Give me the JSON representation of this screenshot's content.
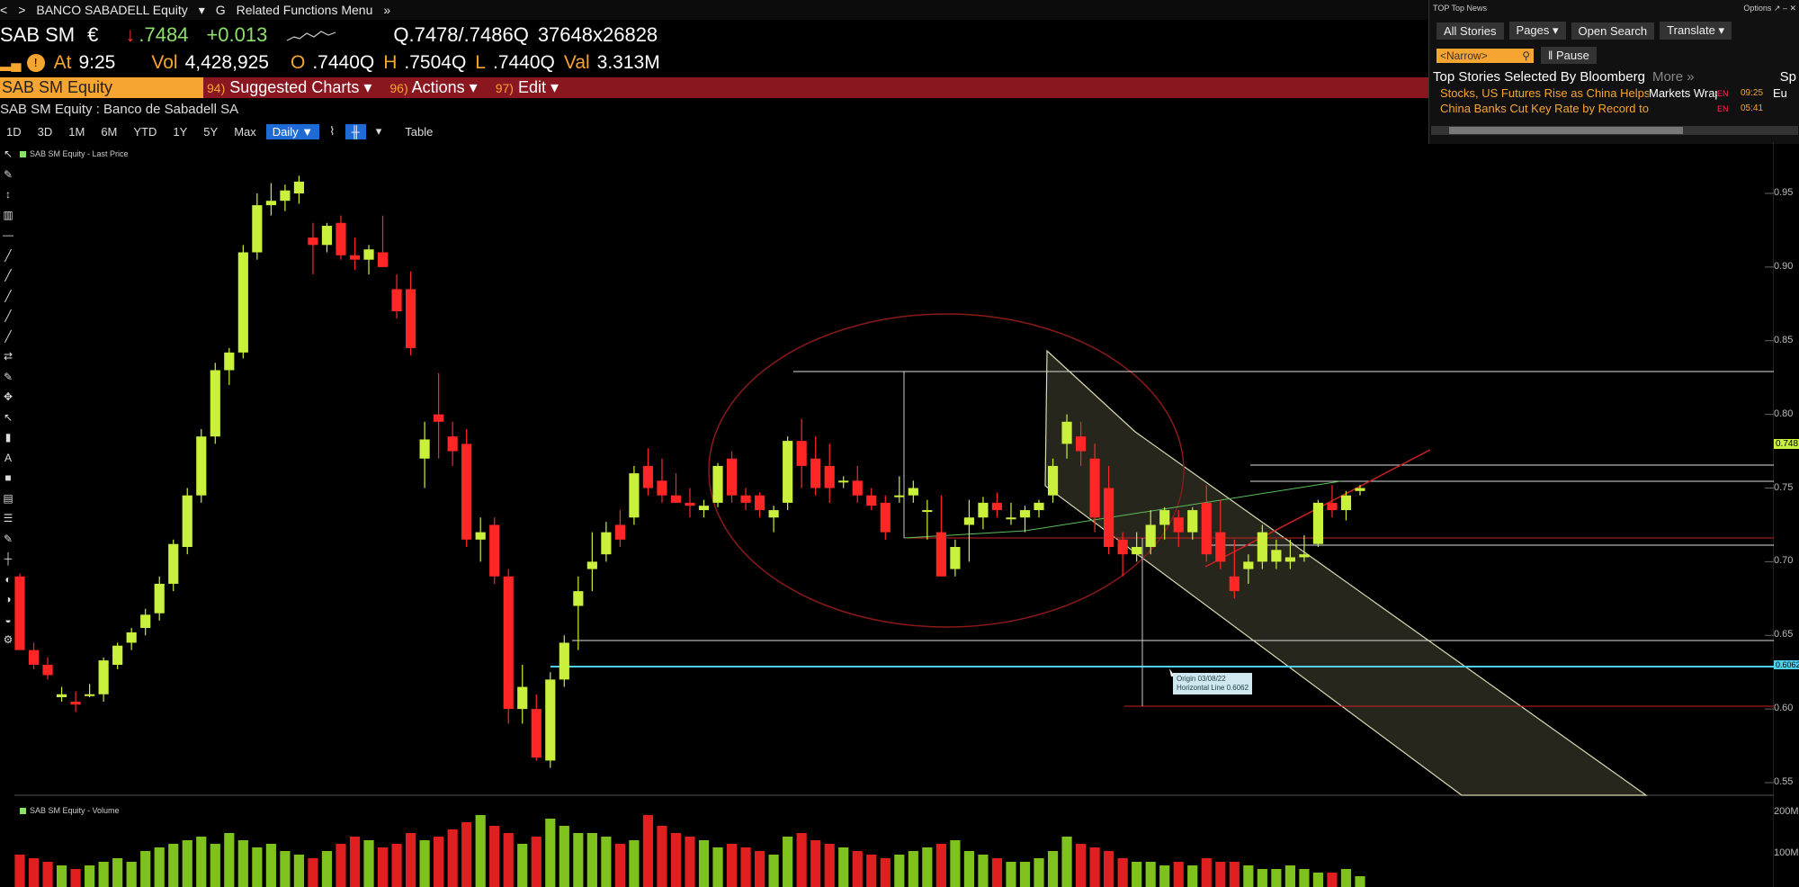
{
  "titlebar": {
    "nav_back": "<",
    "nav_fwd": ">",
    "security": "BANCO SABADELL Equity",
    "menu_g": "G",
    "related": "Related Functions Menu"
  },
  "quote": {
    "ticker": "SAB SM",
    "currency": "€",
    "arrow": "↓",
    "last": ".7484",
    "change": "+0.013",
    "bid_ask": "Q.7478/.7486Q",
    "sizes": "37648x26828",
    "at_label": "At",
    "time": "9:25",
    "vol_label": "Vol",
    "volume": "4,428,925",
    "open_label": "O",
    "open": ".7440Q",
    "high_label": "H",
    "high": ".7504Q",
    "low_label": "L",
    "low": ".7440Q",
    "val_label": "Val",
    "value": "3.313M"
  },
  "menubar": {
    "tab": "SAB SM Equity",
    "suggested_num": "94)",
    "suggested": "Suggested Charts",
    "actions_num": "96)",
    "actions": "Actions",
    "edit_num": "97)",
    "edit": "Edit"
  },
  "security_name": "SAB SM Equity : Banco de Sabadell SA",
  "toolbar": {
    "ranges": [
      "1D",
      "3D",
      "1M",
      "6M",
      "YTD",
      "1Y",
      "5Y",
      "Max"
    ],
    "period": "Daily",
    "table": "Table"
  },
  "chart_legend_price": "SAB SM Equity - Last Price",
  "chart_legend_volume": "SAB SM Equity - Volume",
  "annotation": {
    "line1": "Origin 03/08/22",
    "line2": "Horizontal Line 0.6062"
  },
  "price_tag": "0.748",
  "line_tag": "0.6062",
  "news": {
    "header": "TOP Top News",
    "options": "Options",
    "buttons": [
      "All Stories",
      "Pages",
      "Open Search",
      "Translate"
    ],
    "narrow": "<Narrow>",
    "pause": "Pause",
    "title": "Top Stories Selected By Bloomberg",
    "more": "More »",
    "side_top": "Sp",
    "side_mid": "Eu",
    "stories": [
      {
        "headline": "Stocks, US Futures Rise as China Helps…",
        "source": "Markets Wrap",
        "lang": "EN",
        "time": "09:25"
      },
      {
        "headline": "China Banks Cut Key Rate by Record to Boost Ailing…",
        "source": "",
        "lang": "EN",
        "time": "05:41"
      }
    ]
  },
  "colors": {
    "up": "#c8f03c",
    "down": "#ff2626",
    "accent": "#f7a531",
    "menubar": "#8a1620"
  },
  "chart_data": {
    "type": "candlestick",
    "yaxis_ticks": [
      0.95,
      0.9,
      0.85,
      0.8,
      0.75,
      0.7,
      0.65,
      0.6,
      0.55
    ],
    "ylim": [
      0.535,
      0.985
    ],
    "volume_ticks": [
      "200M",
      "100M"
    ],
    "candles": [
      [
        0.69,
        0.692,
        0.64,
        0.64
      ],
      [
        0.64,
        0.645,
        0.627,
        0.63
      ],
      [
        0.63,
        0.635,
        0.62,
        0.623
      ],
      [
        0.608,
        0.615,
        0.605,
        0.61
      ],
      [
        0.605,
        0.612,
        0.598,
        0.603
      ],
      [
        0.61,
        0.617,
        0.608,
        0.61
      ],
      [
        0.61,
        0.635,
        0.605,
        0.633
      ],
      [
        0.63,
        0.645,
        0.627,
        0.643
      ],
      [
        0.645,
        0.655,
        0.64,
        0.652
      ],
      [
        0.655,
        0.668,
        0.65,
        0.664
      ],
      [
        0.665,
        0.69,
        0.66,
        0.685
      ],
      [
        0.685,
        0.715,
        0.68,
        0.712
      ],
      [
        0.71,
        0.75,
        0.705,
        0.745
      ],
      [
        0.745,
        0.79,
        0.74,
        0.785
      ],
      [
        0.785,
        0.835,
        0.78,
        0.83
      ],
      [
        0.83,
        0.845,
        0.82,
        0.842
      ],
      [
        0.842,
        0.915,
        0.838,
        0.91
      ],
      [
        0.91,
        0.95,
        0.905,
        0.942
      ],
      [
        0.942,
        0.957,
        0.935,
        0.945
      ],
      [
        0.945,
        0.956,
        0.938,
        0.952
      ],
      [
        0.95,
        0.962,
        0.943,
        0.958
      ],
      [
        0.92,
        0.93,
        0.895,
        0.915
      ],
      [
        0.915,
        0.93,
        0.91,
        0.928
      ],
      [
        0.93,
        0.935,
        0.905,
        0.908
      ],
      [
        0.908,
        0.92,
        0.898,
        0.905
      ],
      [
        0.905,
        0.915,
        0.895,
        0.912
      ],
      [
        0.91,
        0.935,
        0.9,
        0.9
      ],
      [
        0.885,
        0.895,
        0.865,
        0.87
      ],
      [
        0.885,
        0.897,
        0.84,
        0.845
      ],
      [
        0.77,
        0.795,
        0.75,
        0.783
      ],
      [
        0.8,
        0.828,
        0.77,
        0.795
      ],
      [
        0.785,
        0.795,
        0.765,
        0.775
      ],
      [
        0.78,
        0.79,
        0.71,
        0.715
      ],
      [
        0.715,
        0.73,
        0.7,
        0.72
      ],
      [
        0.725,
        0.73,
        0.685,
        0.69
      ],
      [
        0.69,
        0.695,
        0.59,
        0.6
      ],
      [
        0.6,
        0.63,
        0.59,
        0.615
      ],
      [
        0.6,
        0.61,
        0.565,
        0.567
      ],
      [
        0.565,
        0.625,
        0.56,
        0.62
      ],
      [
        0.62,
        0.65,
        0.615,
        0.645
      ],
      [
        0.67,
        0.69,
        0.64,
        0.68
      ],
      [
        0.695,
        0.72,
        0.68,
        0.7
      ],
      [
        0.705,
        0.727,
        0.7,
        0.72
      ],
      [
        0.725,
        0.735,
        0.71,
        0.715
      ],
      [
        0.73,
        0.765,
        0.725,
        0.76
      ],
      [
        0.765,
        0.777,
        0.745,
        0.75
      ],
      [
        0.755,
        0.77,
        0.74,
        0.745
      ],
      [
        0.745,
        0.76,
        0.74,
        0.74
      ],
      [
        0.74,
        0.75,
        0.73,
        0.738
      ],
      [
        0.735,
        0.742,
        0.73,
        0.738
      ],
      [
        0.74,
        0.767,
        0.737,
        0.765
      ],
      [
        0.77,
        0.775,
        0.74,
        0.745
      ],
      [
        0.745,
        0.75,
        0.735,
        0.74
      ],
      [
        0.745,
        0.747,
        0.73,
        0.735
      ],
      [
        0.73,
        0.738,
        0.72,
        0.735
      ],
      [
        0.74,
        0.785,
        0.735,
        0.782
      ],
      [
        0.782,
        0.797,
        0.75,
        0.765
      ],
      [
        0.77,
        0.785,
        0.745,
        0.75
      ],
      [
        0.765,
        0.78,
        0.74,
        0.75
      ],
      [
        0.755,
        0.758,
        0.75,
        0.755
      ],
      [
        0.755,
        0.765,
        0.74,
        0.745
      ],
      [
        0.745,
        0.75,
        0.735,
        0.738
      ],
      [
        0.74,
        0.745,
        0.715,
        0.72
      ],
      [
        0.745,
        0.758,
        0.74,
        0.745
      ],
      [
        0.745,
        0.755,
        0.74,
        0.75
      ],
      [
        0.735,
        0.742,
        0.715,
        0.735
      ],
      [
        0.72,
        0.745,
        0.69,
        0.69
      ],
      [
        0.695,
        0.715,
        0.69,
        0.71
      ],
      [
        0.725,
        0.742,
        0.7,
        0.73
      ],
      [
        0.73,
        0.744,
        0.722,
        0.74
      ],
      [
        0.74,
        0.747,
        0.73,
        0.735
      ],
      [
        0.73,
        0.74,
        0.725,
        0.73
      ],
      [
        0.73,
        0.738,
        0.72,
        0.735
      ],
      [
        0.735,
        0.742,
        0.73,
        0.74
      ],
      [
        0.745,
        0.77,
        0.74,
        0.765
      ],
      [
        0.78,
        0.8,
        0.77,
        0.795
      ],
      [
        0.785,
        0.795,
        0.765,
        0.775
      ],
      [
        0.77,
        0.78,
        0.72,
        0.73
      ],
      [
        0.75,
        0.765,
        0.705,
        0.71
      ],
      [
        0.715,
        0.72,
        0.69,
        0.705
      ],
      [
        0.705,
        0.72,
        0.7,
        0.71
      ],
      [
        0.71,
        0.735,
        0.705,
        0.725
      ],
      [
        0.725,
        0.737,
        0.715,
        0.735
      ],
      [
        0.73,
        0.735,
        0.71,
        0.72
      ],
      [
        0.72,
        0.737,
        0.715,
        0.735
      ],
      [
        0.74,
        0.752,
        0.7,
        0.705
      ],
      [
        0.72,
        0.742,
        0.695,
        0.7
      ],
      [
        0.69,
        0.715,
        0.675,
        0.68
      ],
      [
        0.695,
        0.705,
        0.685,
        0.7
      ],
      [
        0.7,
        0.725,
        0.695,
        0.72
      ],
      [
        0.7,
        0.715,
        0.695,
        0.708
      ],
      [
        0.7,
        0.715,
        0.695,
        0.703
      ],
      [
        0.703,
        0.718,
        0.7,
        0.705
      ],
      [
        0.712,
        0.742,
        0.71,
        0.74
      ],
      [
        0.74,
        0.752,
        0.73,
        0.735
      ],
      [
        0.735,
        0.748,
        0.728,
        0.745
      ],
      [
        0.748,
        0.752,
        0.745,
        0.75
      ]
    ],
    "volume": [
      18,
      16,
      14,
      12,
      10,
      12,
      14,
      16,
      14,
      20,
      22,
      24,
      26,
      28,
      24,
      30,
      26,
      22,
      24,
      20,
      18,
      16,
      20,
      24,
      28,
      26,
      22,
      24,
      30,
      26,
      28,
      32,
      36,
      40,
      34,
      30,
      24,
      28,
      38,
      34,
      30,
      30,
      28,
      24,
      26,
      40,
      34,
      30,
      28,
      26,
      22,
      24,
      22,
      20,
      18,
      28,
      30,
      26,
      24,
      22,
      20,
      18,
      16,
      18,
      20,
      22,
      24,
      26,
      20,
      18,
      16,
      14,
      14,
      16,
      20,
      28,
      24,
      22,
      20,
      16,
      14,
      14,
      12,
      14,
      12,
      16,
      14,
      14,
      12,
      10,
      10,
      12,
      10,
      8,
      8,
      10,
      6
    ]
  }
}
